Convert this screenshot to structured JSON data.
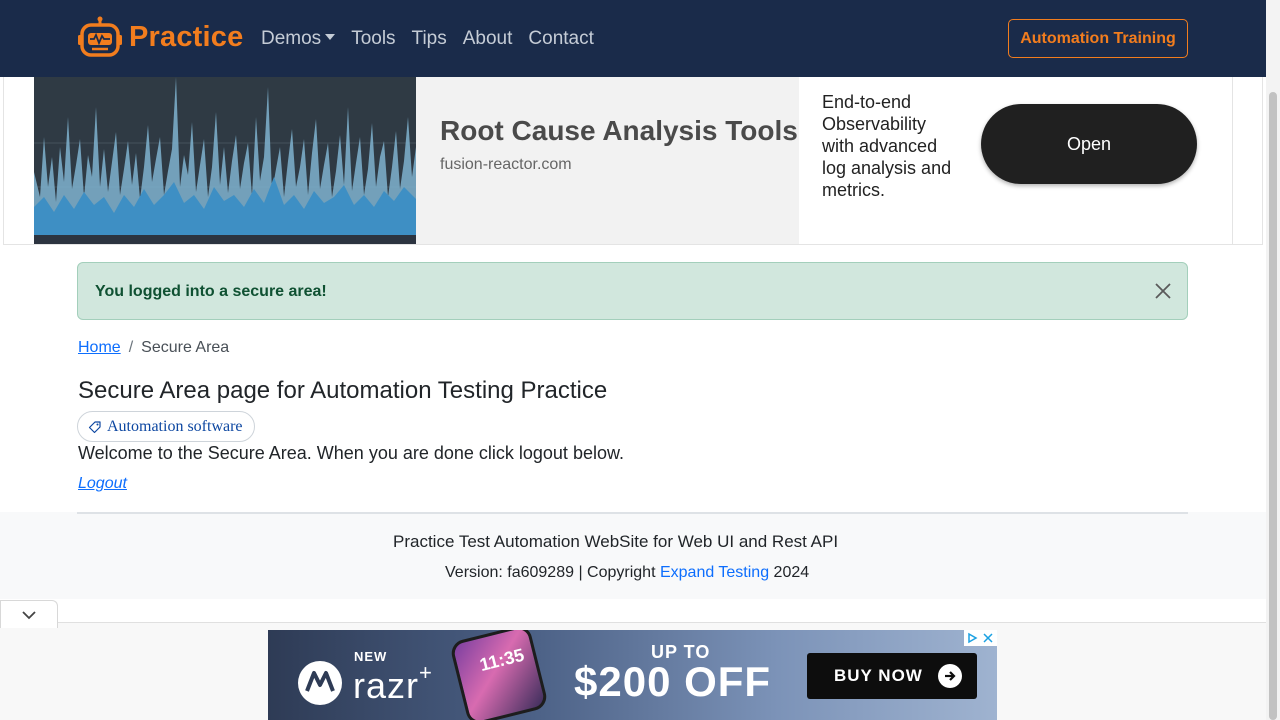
{
  "navbar": {
    "brand": "Practice",
    "links": [
      "Demos",
      "Tools",
      "Tips",
      "About",
      "Contact"
    ],
    "cta": "Automation Training"
  },
  "top_ad": {
    "title": "Root Cause Analysis Tools",
    "domain": "fusion-reactor.com",
    "description": "End-to-end Observability with advanced log analysis and metrics.",
    "button": "Open"
  },
  "flash": {
    "message": "You logged into a secure area!"
  },
  "breadcrumb": {
    "home": "Home",
    "separator": "/",
    "current": "Secure Area"
  },
  "main": {
    "title": "Secure Area page for Automation Testing Practice",
    "tag": "Automation software",
    "welcome": "Welcome to the Secure Area. When you are done click logout below.",
    "logout": "Logout"
  },
  "footer": {
    "title": "Practice Test Automation WebSite for Web UI and Rest API",
    "version_prefix": "Version: fa609289 | Copyright",
    "link": "Expand Testing",
    "year": "2024"
  },
  "bottom_ad": {
    "new": "NEW",
    "brand": "razr",
    "plus": "+",
    "phone_time": "11:35",
    "upto": "UP TO",
    "offer": "$200 OFF",
    "button": "BUY NOW"
  },
  "colors": {
    "navbar_bg": "#1a2b4a",
    "brand_orange": "#f27d1e",
    "flash_bg": "#d1e7dd",
    "flash_text": "#0f5132",
    "link_blue": "#0d6efd"
  }
}
